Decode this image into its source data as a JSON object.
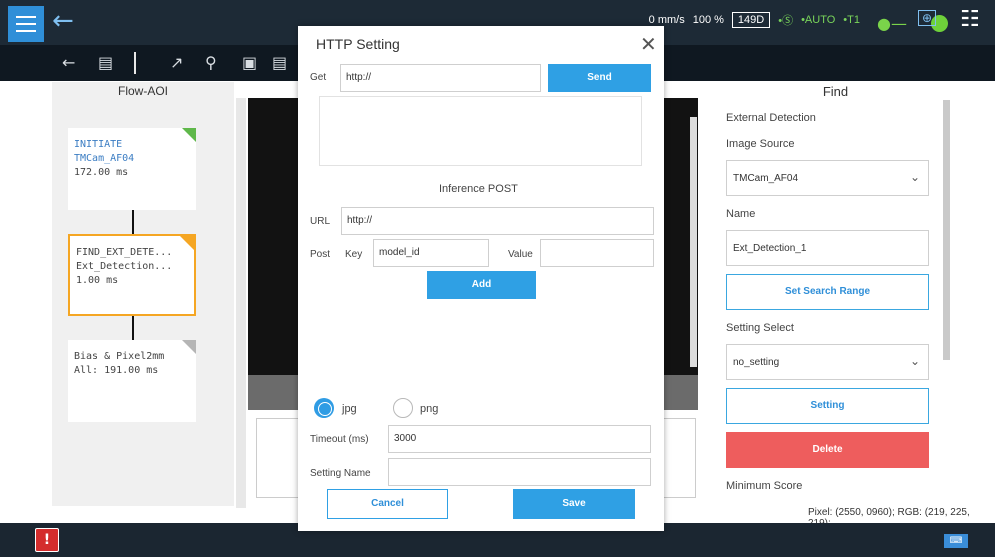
{
  "topbar": {
    "speed": "0 mm/s",
    "percent": "100 %",
    "code": "149D",
    "mode_s": "•Ⓢ",
    "mode_auto": "•AUTO",
    "mode_t1": "•T1"
  },
  "flow": {
    "title": "Flow-AOI",
    "nodes": [
      {
        "line1": "INITIATE",
        "line2": "TMCam_AF04",
        "line3": "172.00 ms",
        "tag_color": "#5fb84a"
      },
      {
        "line1": "FIND_EXT_DETE...",
        "line2": "Ext_Detection...",
        "line3": "1.00 ms",
        "tag_color": "#f5a623"
      },
      {
        "line1": "Bias & Pixel2mm",
        "line2": "",
        "line3": "All: 191.00 ms",
        "tag_color": "#b5b5b5"
      }
    ]
  },
  "find": {
    "title": "Find",
    "section": "External Detection",
    "image_source_label": "Image Source",
    "image_source_value": "TMCam_AF04",
    "name_label": "Name",
    "name_value": "Ext_Detection_1",
    "set_search_range": "Set Search Range",
    "setting_select_label": "Setting Select",
    "setting_select_value": "no_setting",
    "setting_button": "Setting",
    "delete_button": "Delete",
    "minimum_score_label": "Minimum Score"
  },
  "pixel_info": "Pixel: (2550, 0960); RGB: (219, 225, 219);",
  "modal": {
    "title": "HTTP Setting",
    "get_label": "Get",
    "get_value": "http://",
    "send_button": "Send",
    "inference_post_label": "Inference POST",
    "url_label": "URL",
    "url_value": "http://",
    "post_label": "Post",
    "key_label": "Key",
    "key_value": "model_id",
    "value_label": "Value",
    "value_value": "",
    "add_button": "Add",
    "format_jpg": "jpg",
    "format_png": "png",
    "selected_format": "jpg",
    "timeout_label": "Timeout (ms)",
    "timeout_value": "3000",
    "setting_name_label": "Setting Name",
    "setting_name_value": "",
    "cancel_button": "Cancel",
    "save_button": "Save"
  },
  "colors": {
    "accent": "#2fa0e4",
    "delete": "#ee5d5d",
    "topbar": "#1d2a36",
    "node_active": "#f5a623"
  }
}
